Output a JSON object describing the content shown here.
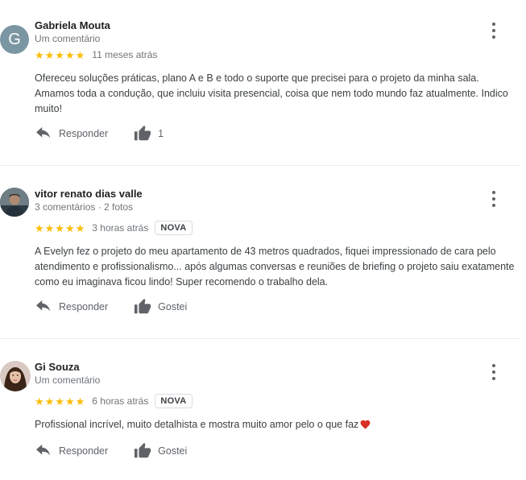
{
  "reviews": [
    {
      "avatar_letter": "G",
      "name": "Gabriela Mouta",
      "meta": "Um comentário",
      "stars": "★★★★★",
      "rating": 5,
      "time": "11 meses atrás",
      "badge": "",
      "text": "Ofereceu soluções práticas, plano A e B e todo o suporte que precisei para o projeto da minha sala. Amamos toda a condução, que incluiu visita presencial, coisa que nem todo mundo faz atualmente. Indico muito!",
      "reply_label": "Responder",
      "like_label": "1"
    },
    {
      "avatar_letter": "",
      "name": "vitor renato dias valle",
      "meta": "3 comentários · 2 fotos",
      "stars": "★★★★★",
      "rating": 5,
      "time": "3 horas atrás",
      "badge": "NOVA",
      "text": "A Evelyn fez o projeto do meu apartamento de 43 metros quadrados, fiquei impressionado de cara pelo atendimento e profissionalismo... após algumas conversas e reuniões de briefing o projeto saiu exatamente como eu imaginava ficou lindo! Super recomendo o trabalho dela.",
      "reply_label": "Responder",
      "like_label": "Gostei"
    },
    {
      "avatar_letter": "",
      "name": "Gi Souza",
      "meta": "Um comentário",
      "stars": "★★★★★",
      "rating": 5,
      "time": "6 horas atrás",
      "badge": "NOVA",
      "text": "Profissional incrível, muito detalhista e mostra muito amor pelo o que faz",
      "reply_label": "Responder",
      "like_label": "Gostei"
    }
  ],
  "colors": {
    "star": "#fbbc04",
    "avatar_bg": "#7b96a3",
    "heart": "#d93025",
    "icon": "#5f6368"
  },
  "icons": {
    "more": "more-vert-icon",
    "reply": "reply-arrow-icon",
    "like": "thumb-up-icon",
    "heart": "heart-emoji-icon"
  }
}
